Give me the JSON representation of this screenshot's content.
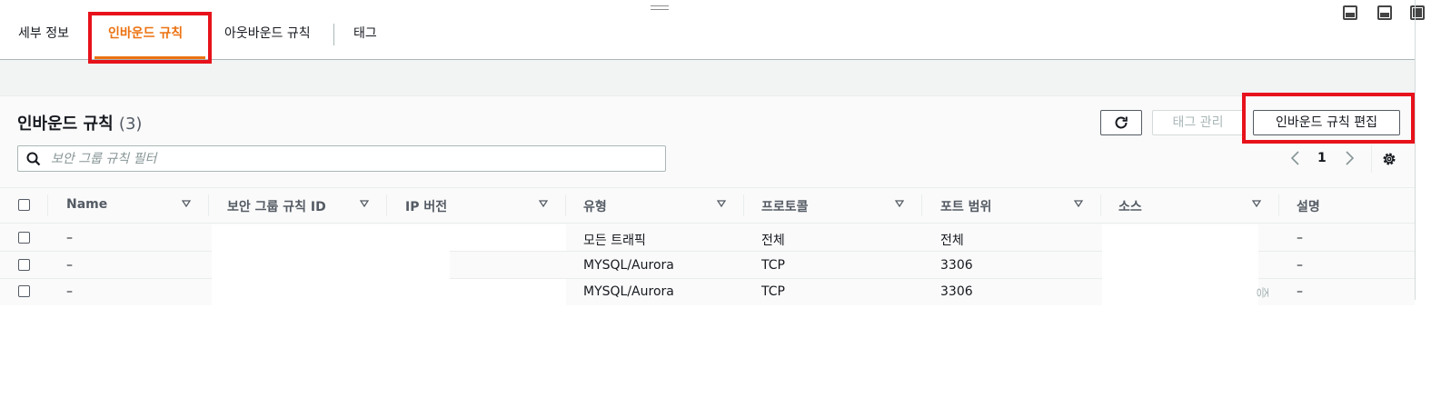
{
  "tabs": [
    {
      "label": "세부 정보"
    },
    {
      "label": "인바운드 규칙"
    },
    {
      "label": "아웃바운드 규칙"
    },
    {
      "label": "태그"
    }
  ],
  "panel": {
    "title": "인바운드 규칙",
    "count": "(3)",
    "manage_tags_label": "태그 관리",
    "edit_rules_label": "인바운드 규칙 편집"
  },
  "search": {
    "placeholder": "보안 그룹 규칙 필터",
    "value": ""
  },
  "pagination": {
    "page": "1"
  },
  "table": {
    "columns": [
      "Name",
      "보안 그룹 규칙 ID",
      "IP 버전",
      "유형",
      "프로토콜",
      "포트 범위",
      "소스",
      "설명"
    ],
    "rows": [
      {
        "name": "–",
        "type": "모든 트래픽",
        "protocol": "전체",
        "port": "전체",
        "description": "–"
      },
      {
        "name": "–",
        "type": "MYSQL/Aurora",
        "protocol": "TCP",
        "port": "3306",
        "description": "–"
      },
      {
        "name": "–",
        "type": "MYSQL/Aurora",
        "protocol": "TCP",
        "port": "3306",
        "description": "–"
      }
    ]
  },
  "overflow_glyph": "증",
  "colors": {
    "accent": "#ec7211",
    "highlight": "#e7121b",
    "border": "#aab7b8"
  }
}
